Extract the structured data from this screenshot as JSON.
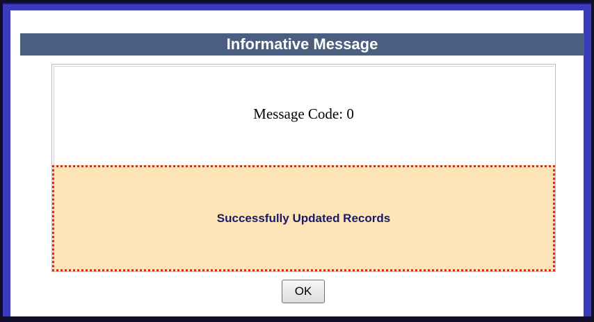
{
  "dialog": {
    "title": "Informative Message",
    "message_code_text": "Message Code: 0",
    "status_message": "Successfully Updated Records",
    "ok_label": "OK"
  },
  "colors": {
    "title_bar": "#4a5e80",
    "status_background": "#fde4b7",
    "status_border": "#ff1a1a",
    "status_text": "#1a1a66",
    "frame": "#3b3bbf"
  }
}
